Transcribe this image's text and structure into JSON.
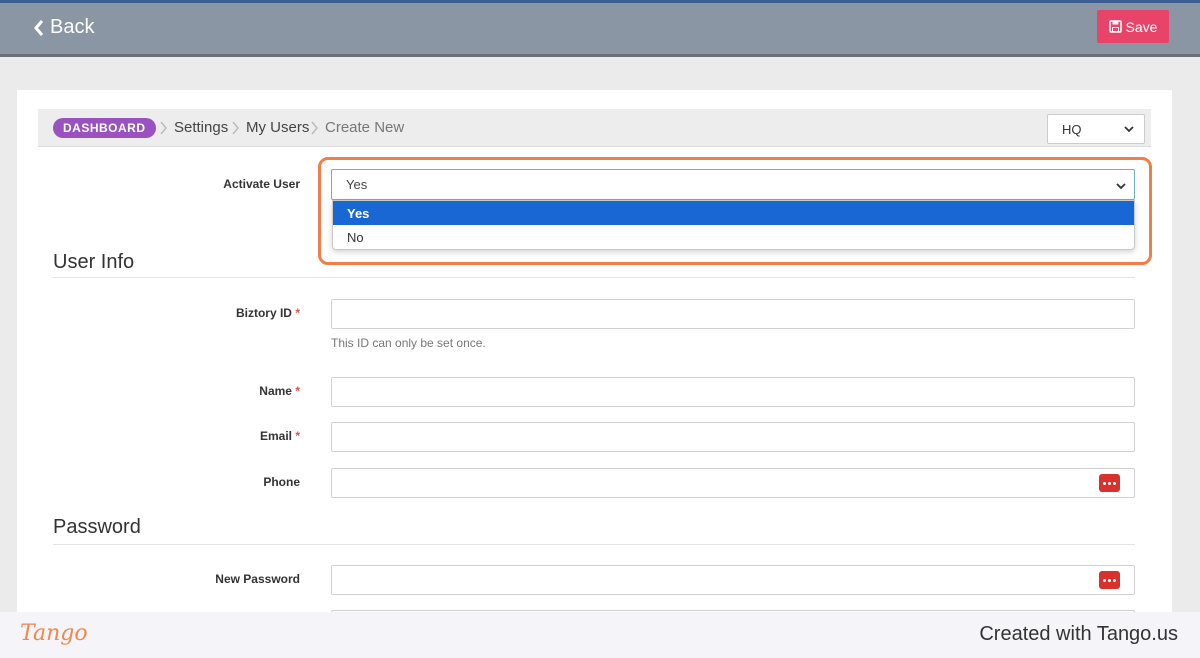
{
  "topbar": {
    "back_label": "Back",
    "save_label": "Save"
  },
  "breadcrumb": {
    "dashboard": "DASHBOARD",
    "items": [
      "Settings",
      "My Users",
      "Create New"
    ]
  },
  "location_select": {
    "value": "HQ"
  },
  "activate_user": {
    "label": "Activate User",
    "value": "Yes",
    "options": [
      {
        "label": "Yes",
        "selected": true
      },
      {
        "label": "No",
        "selected": false
      }
    ]
  },
  "user_info": {
    "title": "User Info",
    "biztory_id": {
      "label": "Biztory ID",
      "required_mark": "*",
      "help": "This ID can only be set once."
    },
    "name": {
      "label": "Name",
      "required_mark": "*"
    },
    "email": {
      "label": "Email",
      "required_mark": "*"
    },
    "phone": {
      "label": "Phone"
    }
  },
  "password": {
    "title": "Password",
    "new_password": {
      "label": "New Password"
    }
  },
  "footer": {
    "logo": "Tango",
    "created": "Created with Tango.us"
  },
  "colors": {
    "accent_save": "#e8446a",
    "dashboard_pill": "#9a52c0",
    "highlight": "#f07d4a",
    "selected_option": "#1967d2"
  }
}
